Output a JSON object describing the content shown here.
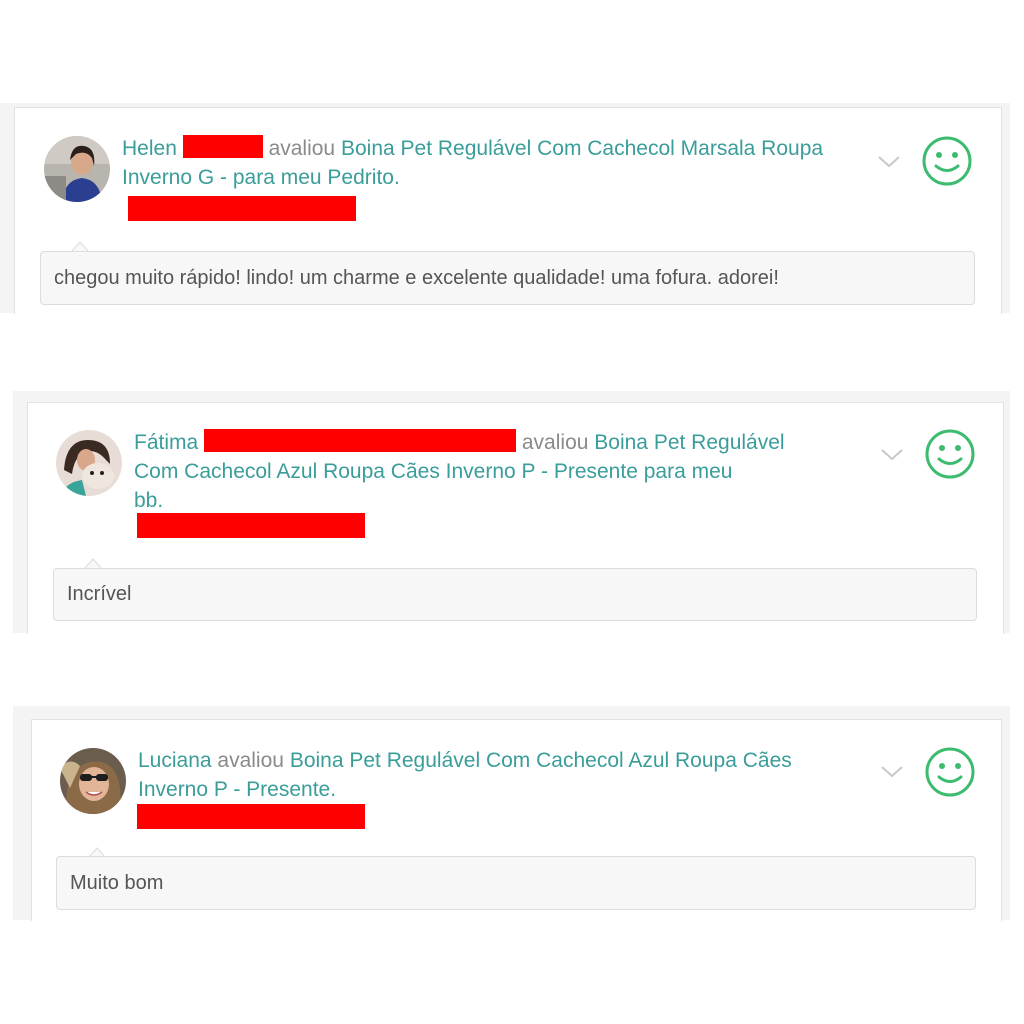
{
  "reviews": [
    {
      "name": "Helen",
      "verb": "avaliou",
      "product": "Boina Pet Regulável Com Cachecol Marsala Roupa Inverno G - para meu Pedrito.",
      "comment": "chegou muito rápido! lindo! um charme e excelente qualidade! uma fofura. adorei!",
      "sentiment_icon": "smiley-icon",
      "expand_icon": "chevron-down-icon"
    },
    {
      "name": "Fátima",
      "verb": "avaliou",
      "product_line1": "Boina Pet Regulável",
      "product_line2": "Com Cachecol Azul Roupa Cães Inverno P - Presente para meu",
      "product_line3": "bb.",
      "comment": "Incrível",
      "sentiment_icon": "smiley-icon",
      "expand_icon": "chevron-down-icon"
    },
    {
      "name": "Luciana",
      "verb": "avaliou",
      "product": "Boina Pet Regulável Com Cachecol Azul Roupa Cães Inverno P - Presente.",
      "comment": "Muito bom",
      "sentiment_icon": "smiley-icon",
      "expand_icon": "chevron-down-icon"
    }
  ],
  "colors": {
    "link": "#3a9d9a",
    "smiley": "#3dbb6f",
    "redaction": "#ff0000"
  }
}
